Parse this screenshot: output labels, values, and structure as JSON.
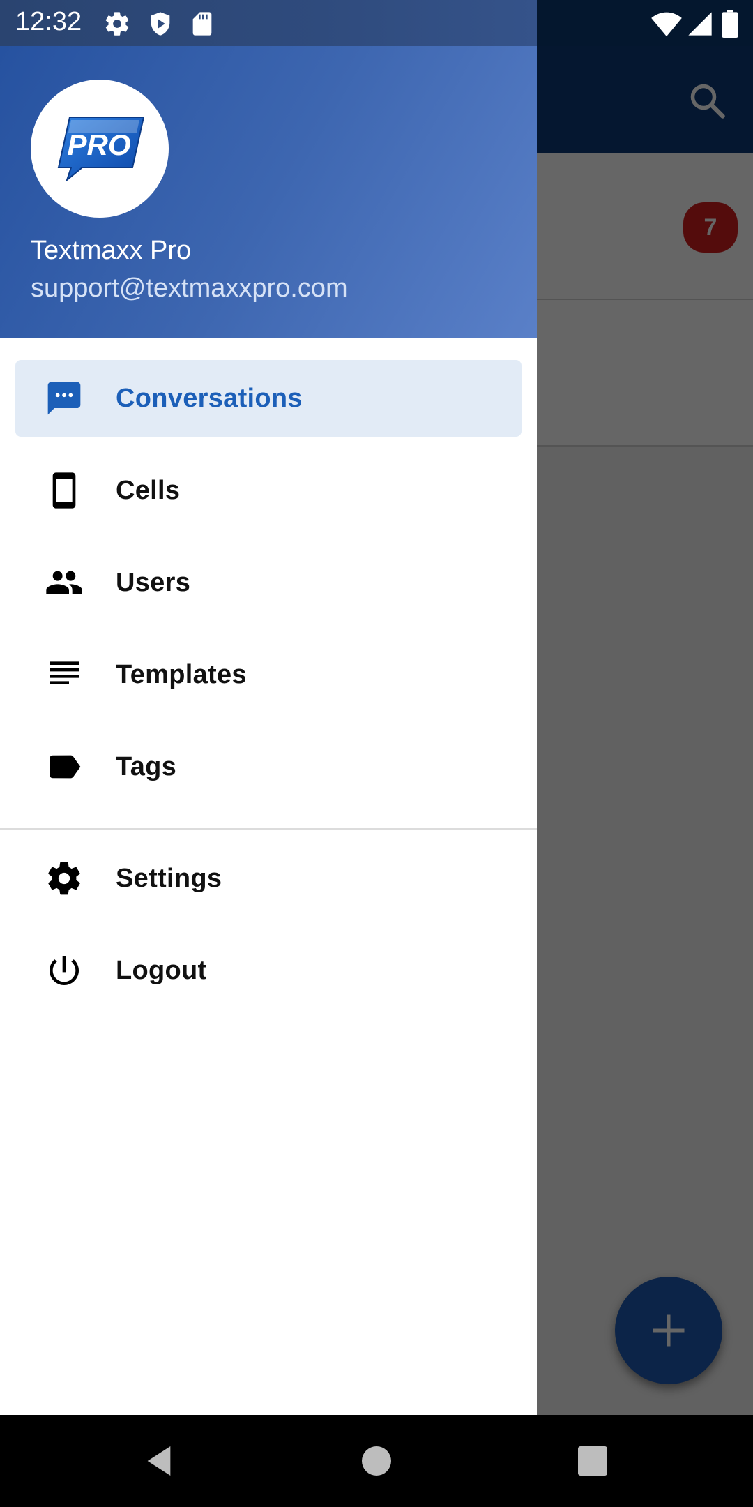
{
  "status_bar": {
    "time": "12:32",
    "icons_left": [
      "gear-icon",
      "shield-icon",
      "sd-card-icon"
    ],
    "icons_right": [
      "wifi-icon",
      "signal-icon",
      "battery-icon"
    ]
  },
  "drawer": {
    "header": {
      "logo_text": "PRO",
      "name": "Textmaxx Pro",
      "email": "support@textmaxxpro.com"
    },
    "primary_items": [
      {
        "label": "Conversations",
        "icon": "chat-icon",
        "active": true
      },
      {
        "label": "Cells",
        "icon": "phone-icon",
        "active": false
      },
      {
        "label": "Users",
        "icon": "users-icon",
        "active": false
      },
      {
        "label": "Templates",
        "icon": "templates-icon",
        "active": false
      },
      {
        "label": "Tags",
        "icon": "tag-icon",
        "active": false
      }
    ],
    "secondary_items": [
      {
        "label": "Settings",
        "icon": "gear-icon"
      },
      {
        "label": "Logout",
        "icon": "power-icon"
      }
    ]
  },
  "background_app": {
    "unread_badge": "7",
    "fab_label": "+"
  },
  "colors": {
    "accent": "#1c5fb8",
    "header_start": "#2652a0",
    "header_end": "#5a80c8",
    "active_item_bg": "#e2ebf6",
    "badge": "#d32020"
  }
}
